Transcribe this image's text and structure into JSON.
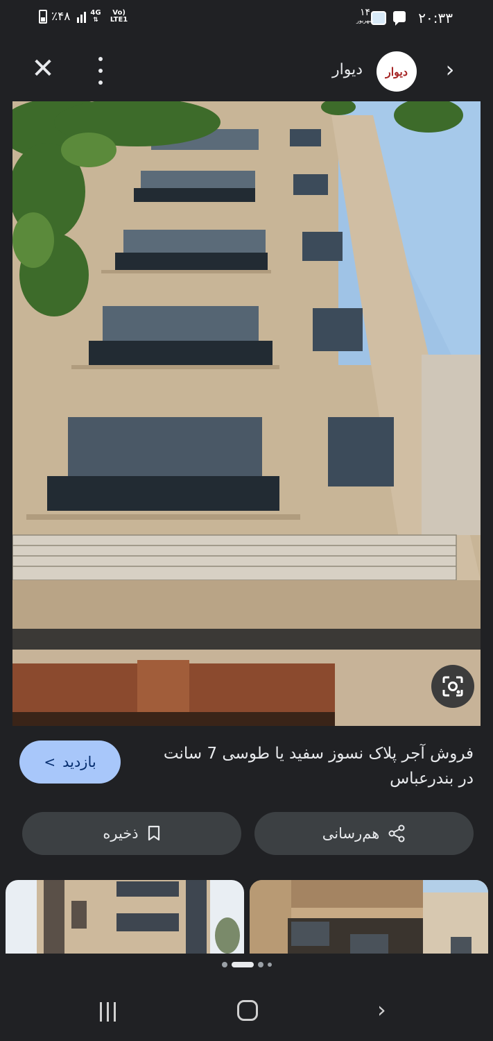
{
  "status_bar": {
    "time": "۲۰:۳۳",
    "date_day": "۱۴",
    "date_month": "شهریور",
    "battery": "٪۴۸",
    "network_top": "4G",
    "network_volte": "Vo) LTE1"
  },
  "top_bar": {
    "site_name": "دیوار",
    "logo_text": "دیوار",
    "close_glyph": "✕",
    "forward_glyph": "›"
  },
  "result": {
    "title": "فروش آجر پلاک نسوز سفید یا طوسی 7 سانت در بندرعباس",
    "visit_label": "بازدید",
    "visit_glyph": "›",
    "share_label": "هم‌رسانی",
    "save_label": "ذخیره"
  },
  "pager": {
    "count": 4,
    "active_index": 1
  },
  "nav": {
    "back_glyph": "›"
  },
  "colors": {
    "background": "#202124",
    "accent": "#a8c7fa",
    "button_bg": "#3c4043"
  }
}
